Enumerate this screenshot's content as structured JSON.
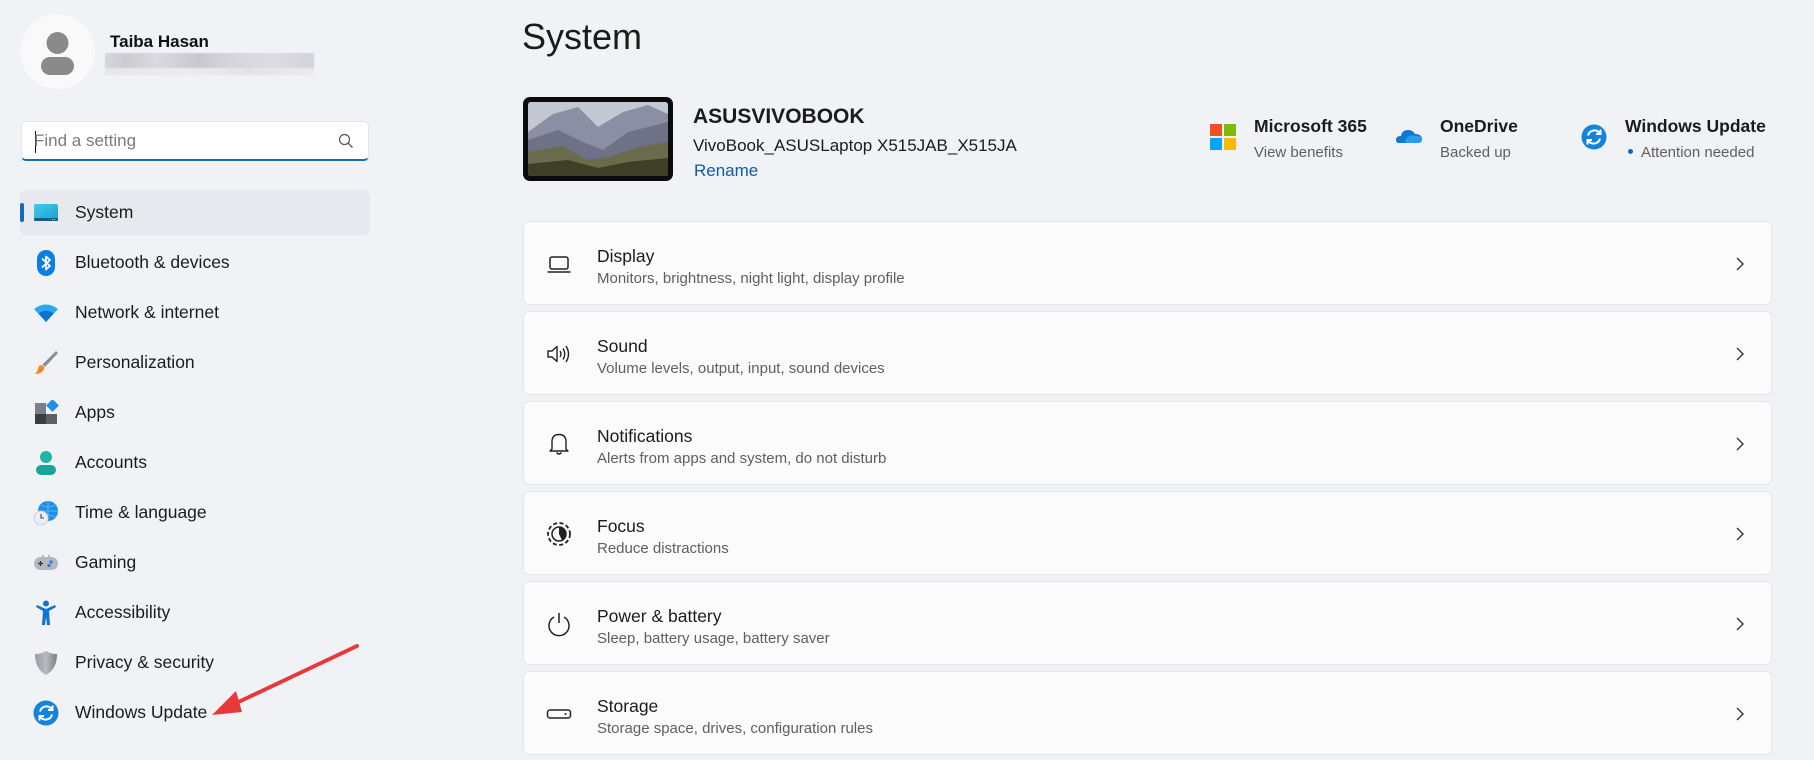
{
  "user": {
    "name": "Taiba Hasan",
    "email_obscured": true
  },
  "search": {
    "placeholder": "Find a setting",
    "value": ""
  },
  "sidebar": {
    "items": [
      {
        "label": "System",
        "icon": "system-icon",
        "active": true
      },
      {
        "label": "Bluetooth & devices",
        "icon": "bluetooth-icon",
        "active": false
      },
      {
        "label": "Network & internet",
        "icon": "wifi-icon",
        "active": false
      },
      {
        "label": "Personalization",
        "icon": "paintbrush-icon",
        "active": false
      },
      {
        "label": "Apps",
        "icon": "apps-icon",
        "active": false
      },
      {
        "label": "Accounts",
        "icon": "account-icon",
        "active": false
      },
      {
        "label": "Time & language",
        "icon": "globe-clock-icon",
        "active": false
      },
      {
        "label": "Gaming",
        "icon": "gamepad-icon",
        "active": false
      },
      {
        "label": "Accessibility",
        "icon": "accessibility-icon",
        "active": false
      },
      {
        "label": "Privacy & security",
        "icon": "shield-icon",
        "active": false
      },
      {
        "label": "Windows Update",
        "icon": "update-icon",
        "active": false
      }
    ]
  },
  "main": {
    "title": "System",
    "device": {
      "name": "ASUSVIVOBOOK",
      "model": "VivoBook_ASUSLaptop X515JAB_X515JA",
      "rename_label": "Rename"
    },
    "quick_links": [
      {
        "title": "Microsoft 365",
        "subtitle": "View benefits",
        "icon": "microsoft-logo-icon"
      },
      {
        "title": "OneDrive",
        "subtitle": "Backed up",
        "icon": "onedrive-cloud-icon"
      },
      {
        "title": "Windows Update",
        "subtitle": "Attention needed",
        "icon": "update-icon",
        "status_dot": true
      }
    ],
    "cards": [
      {
        "title": "Display",
        "subtitle": "Monitors, brightness, night light, display profile",
        "icon": "laptop-icon"
      },
      {
        "title": "Sound",
        "subtitle": "Volume levels, output, input, sound devices",
        "icon": "speaker-icon"
      },
      {
        "title": "Notifications",
        "subtitle": "Alerts from apps and system, do not disturb",
        "icon": "bell-icon"
      },
      {
        "title": "Focus",
        "subtitle": "Reduce distractions",
        "icon": "focus-icon"
      },
      {
        "title": "Power & battery",
        "subtitle": "Sleep, battery usage, battery saver",
        "icon": "power-icon"
      },
      {
        "title": "Storage",
        "subtitle": "Storage space, drives, configuration rules",
        "icon": "storage-drive-icon"
      }
    ]
  },
  "annotation": {
    "type": "arrow",
    "color": "#e5393a",
    "points_to": "Windows Update"
  },
  "colors": {
    "accent": "#0f6cbd",
    "background": "#f1f2f6",
    "card": "#fbfbfc",
    "link": "#0f5ba9"
  }
}
